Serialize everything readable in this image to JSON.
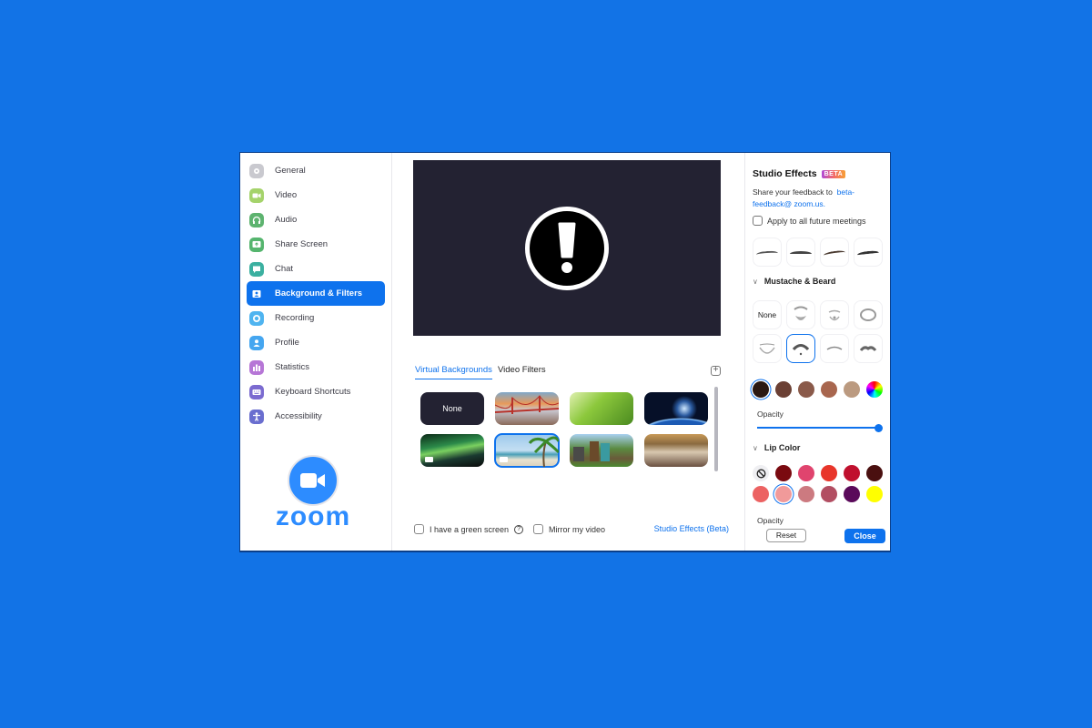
{
  "sidebar": {
    "items": [
      {
        "label": "General",
        "icon": "gear-icon",
        "color": "#c9c9cf"
      },
      {
        "label": "Video",
        "icon": "video-icon",
        "color": "#a5d36b"
      },
      {
        "label": "Audio",
        "icon": "headphones-icon",
        "color": "#5db36f"
      },
      {
        "label": "Share Screen",
        "icon": "share-screen-icon",
        "color": "#55b56e"
      },
      {
        "label": "Chat",
        "icon": "chat-icon",
        "color": "#3bb0a0"
      },
      {
        "label": "Background & Filters",
        "icon": "background-icon",
        "color": "#0e72ed",
        "active": true
      },
      {
        "label": "Recording",
        "icon": "recording-icon",
        "color": "#4fb4f0"
      },
      {
        "label": "Profile",
        "icon": "profile-icon",
        "color": "#45a6f0"
      },
      {
        "label": "Statistics",
        "icon": "statistics-icon",
        "color": "#b676d6"
      },
      {
        "label": "Keyboard Shortcuts",
        "icon": "keyboard-icon",
        "color": "#7b6bd0"
      },
      {
        "label": "Accessibility",
        "icon": "accessibility-icon",
        "color": "#6a6ecf"
      }
    ],
    "logo_text": "zoom"
  },
  "main": {
    "tabs": [
      {
        "label": "Virtual Backgrounds",
        "active": true
      },
      {
        "label": "Video Filters",
        "active": false
      }
    ],
    "add_button": "+",
    "backgrounds": [
      {
        "name": "None",
        "label": "None"
      },
      {
        "name": "Golden Gate Bridge"
      },
      {
        "name": "Grass"
      },
      {
        "name": "Earth from space"
      },
      {
        "name": "Northern lights",
        "video": true
      },
      {
        "name": "Beach",
        "video": true,
        "selected": true
      },
      {
        "name": "Minecraft"
      },
      {
        "name": "Lobby interior"
      }
    ],
    "green_screen_label": "I have a green screen",
    "help_glyph": "?",
    "mirror_label": "Mirror my video",
    "studio_effects_link": "Studio Effects (Beta)"
  },
  "studio": {
    "title": "Studio Effects",
    "badge": "BETA",
    "feedback_text": "Share your feedback to",
    "feedback_link": "beta-feedback@ zoom.us.",
    "apply_label": "Apply to all future meetings",
    "mustache_heading": "Mustache & Beard",
    "mustache_none": "None",
    "mustache_colors": [
      "#2b1812",
      "#6b4034",
      "#8a5a4a",
      "#a8664e",
      "#bb9a80"
    ],
    "opacity_label": "Opacity",
    "opacity_value": 1.0,
    "lip_heading": "Lip Color",
    "lip_colors_row1": [
      "#7a0a10",
      "#e0446e",
      "#e8352a",
      "#c0102e",
      "#4a1010"
    ],
    "lip_colors_row2": [
      "#ec6262",
      "#f19a9a",
      "#cc7a80",
      "#b24e62",
      "#5a0a5a",
      "#ffff00"
    ],
    "lip_opacity_label": "Opacity",
    "reset_label": "Reset",
    "close_label": "Close"
  }
}
